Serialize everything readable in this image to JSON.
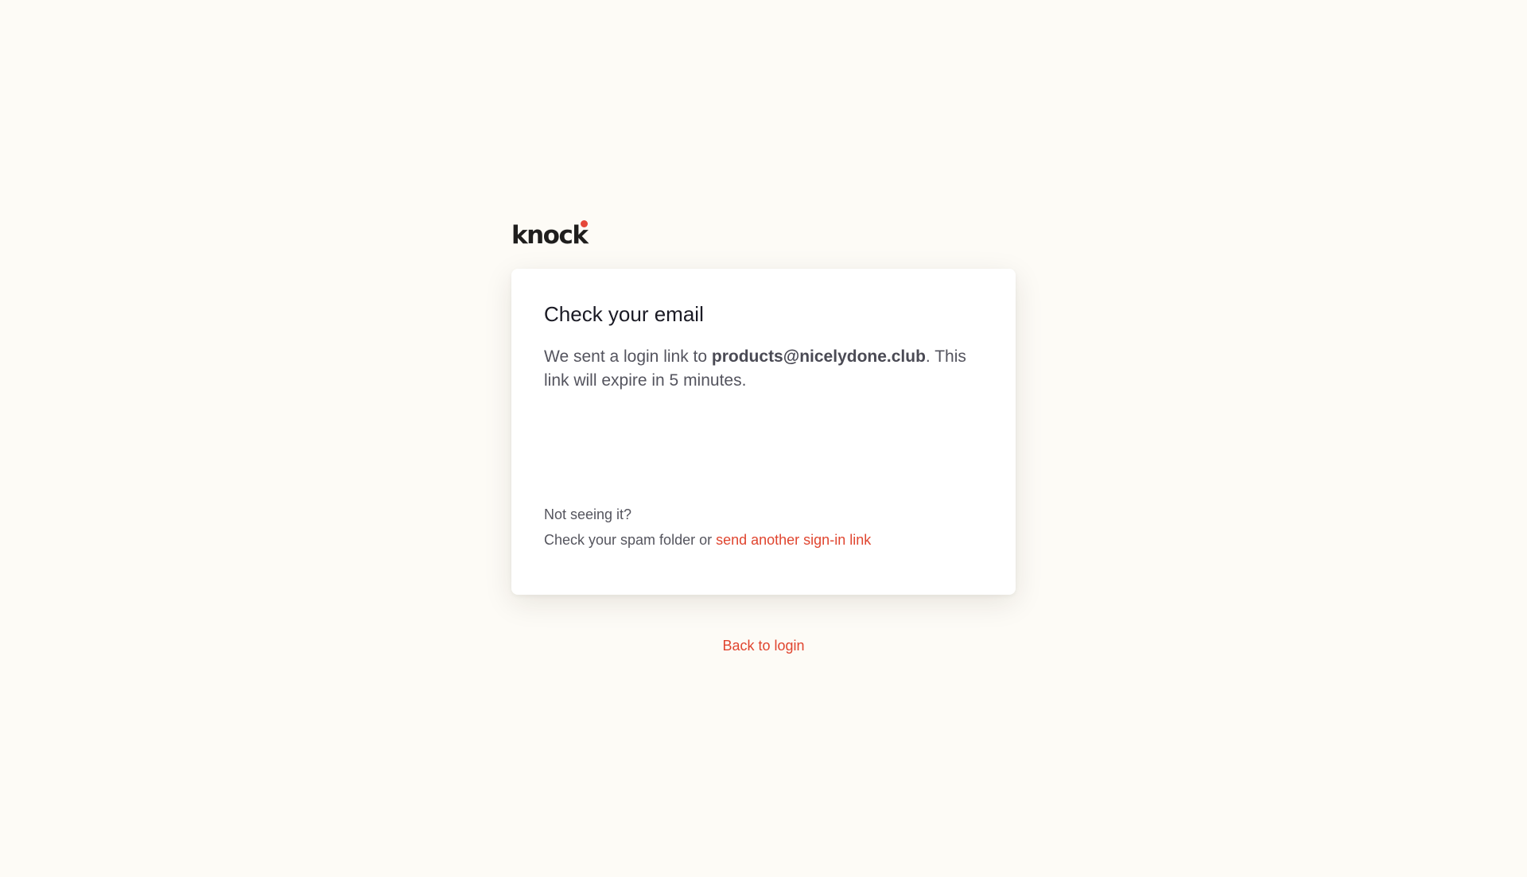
{
  "brand": {
    "logo_text": "knock",
    "accent_color": "#e5473a",
    "link_color": "#e0452f"
  },
  "card": {
    "title": "Check your email",
    "message_prefix": "We sent a login link to ",
    "email": "products@nicelydone.club",
    "message_suffix": ". This link will expire in 5 minutes.",
    "help_title": "Not seeing it?",
    "help_prefix": "Check your spam folder or ",
    "resend_link": "send another sign-in link"
  },
  "footer": {
    "back_link": "Back to login"
  }
}
